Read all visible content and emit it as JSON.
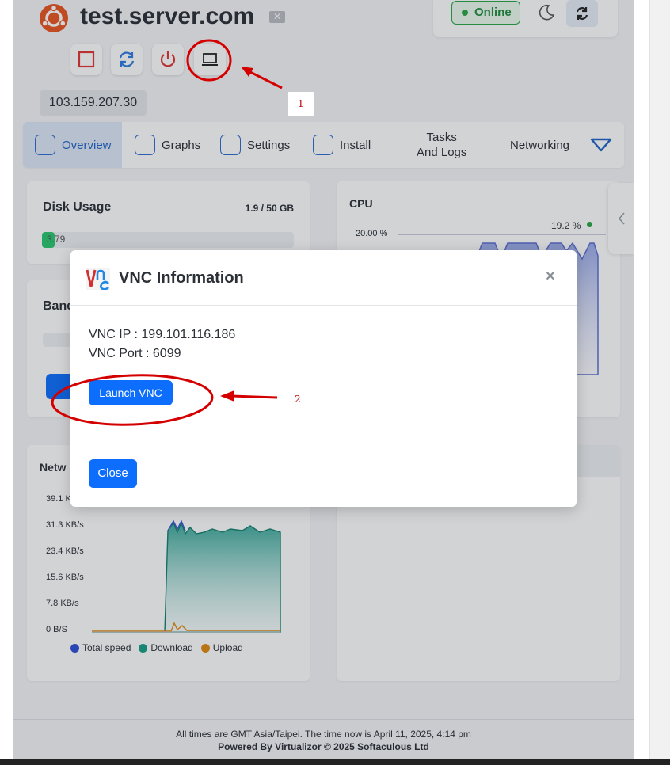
{
  "header": {
    "server_name": "test.server.com",
    "status": "Online",
    "ip": "103.159.207.30"
  },
  "actions": [
    {
      "name": "stop-icon"
    },
    {
      "name": "restart-icon"
    },
    {
      "name": "poweroff-icon"
    },
    {
      "name": "vnc-console-icon"
    }
  ],
  "tabs": [
    {
      "label": "Overview",
      "icon": "cube-icon"
    },
    {
      "label": "Graphs",
      "icon": "chart-line-icon"
    },
    {
      "label": "Settings",
      "icon": "sliders-icon"
    },
    {
      "label": "Install",
      "icon": "git-branch-icon"
    },
    {
      "label_line1": "Tasks",
      "label_line2": "And Logs",
      "icon": "list-icon"
    },
    {
      "label": "Networking",
      "icon": "network-icon"
    }
  ],
  "disk": {
    "title": "Disk Usage",
    "summary": "1.9 / 50 GB",
    "value_label": "3.79",
    "fraction": 0.038
  },
  "cpu": {
    "title": "CPU",
    "current": "19.2 %",
    "y_tick": "20.00 %"
  },
  "bandwidth": {
    "title_partial": "Band"
  },
  "network": {
    "title_partial": "Netw",
    "y_ticks": [
      "39.1 K",
      "31.3 KB/s",
      "23.4 KB/s",
      "15.6 KB/s",
      "7.8 KB/s",
      "0 B/S"
    ],
    "legend": [
      {
        "label": "Total speed",
        "color": "#2d4fd6"
      },
      {
        "label": "Download",
        "color": "#16a085"
      },
      {
        "label": "Upload",
        "color": "#e08a10"
      }
    ]
  },
  "modal": {
    "title": "VNC Information",
    "close_glyph": "×",
    "vnc_ip": "VNC IP : 199.101.116.186",
    "vnc_port": "VNC Port : 6099",
    "launch_label": "Launch VNC",
    "close_label": "Close"
  },
  "annotations": {
    "one": "1",
    "two": "2"
  },
  "footer": {
    "time_note": "All times are GMT Asia/Taipei. The time now is April 11, 2025, 4:14 pm",
    "powered": "Powered By Virtualizor © 2025 Softaculous Ltd"
  },
  "colors": {
    "accent": "#0d6efd",
    "online": "#28a745",
    "annotation": "#d40000"
  }
}
